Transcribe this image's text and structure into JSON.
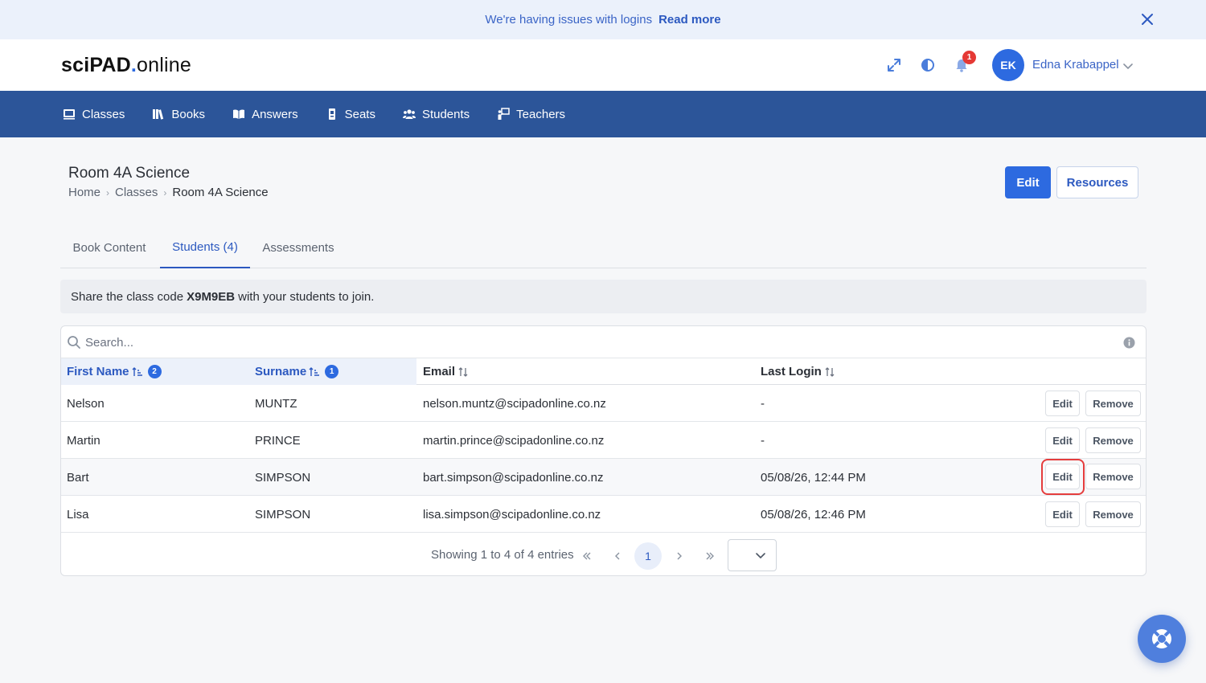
{
  "banner": {
    "message": "We're having issues with logins",
    "link": "Read more"
  },
  "header": {
    "logo_sci": "sci",
    "logo_pad": "PAD",
    "logo_dot": ".",
    "logo_online": "online",
    "notification_count": "1",
    "user_initials": "EK",
    "user_name": "Edna Krabappel"
  },
  "nav": {
    "items": [
      {
        "label": "Classes",
        "icon": "classroom-icon"
      },
      {
        "label": "Books",
        "icon": "books-icon"
      },
      {
        "label": "Answers",
        "icon": "open-book-icon"
      },
      {
        "label": "Seats",
        "icon": "seat-icon"
      },
      {
        "label": "Students",
        "icon": "users-icon"
      },
      {
        "label": "Teachers",
        "icon": "teacher-icon"
      }
    ]
  },
  "page": {
    "title": "Room 4A Science",
    "breadcrumb": [
      "Home",
      "Classes",
      "Room 4A Science"
    ],
    "edit_label": "Edit",
    "resources_label": "Resources"
  },
  "tabs": [
    "Book Content",
    "Students (4)",
    "Assessments"
  ],
  "active_tab": "Students (4)",
  "share": {
    "prefix": "Share the class code",
    "code": "X9M9EB",
    "suffix": "with your students to join."
  },
  "table": {
    "search_placeholder": "Search...",
    "columns": [
      {
        "label": "First Name",
        "sort_order": "2"
      },
      {
        "label": "Surname",
        "sort_order": "1"
      },
      {
        "label": "Email"
      },
      {
        "label": "Last Login"
      }
    ],
    "rows": [
      {
        "first": "Nelson",
        "surname": "MUNTZ",
        "email": "nelson.muntz@scipadonline.co.nz",
        "last_login": "-"
      },
      {
        "first": "Martin",
        "surname": "PRINCE",
        "email": "martin.prince@scipadonline.co.nz",
        "last_login": "-"
      },
      {
        "first": "Bart",
        "surname": "SIMPSON",
        "email": "bart.simpson@scipadonline.co.nz",
        "last_login": "05/08/26, 12:44 PM"
      },
      {
        "first": "Lisa",
        "surname": "SIMPSON",
        "email": "lisa.simpson@scipadonline.co.nz",
        "last_login": "05/08/26, 12:46 PM"
      }
    ],
    "edit_label": "Edit",
    "remove_label": "Remove"
  },
  "pagination": {
    "info": "Showing 1 to 4 of 4 entries",
    "current_page": "1"
  },
  "colors": {
    "primary": "#2d6ae0",
    "nav_bg": "#2c5599",
    "banner_bg": "#ebf1fb",
    "danger": "#e53935"
  }
}
